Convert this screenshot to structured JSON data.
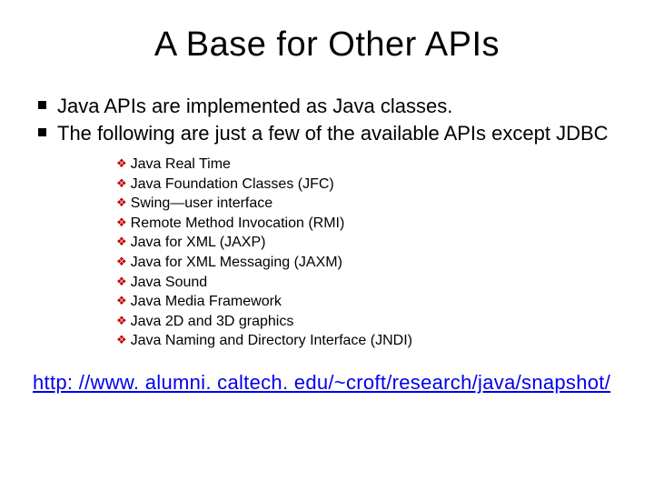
{
  "title": "A Base for Other APIs",
  "level1": [
    "Java APIs  are implemented as Java classes.",
    "The following are just a few of the available APIs except JDBC"
  ],
  "level2": [
    "Java Real Time",
    "Java Foundation Classes (JFC)",
    "Swing—user interface",
    "Remote Method Invocation (RMI)",
    "Java for XML (JAXP)",
    "Java for XML Messaging (JAXM)",
    "Java Sound",
    "Java Media Framework",
    "Java 2D and 3D graphics",
    "Java Naming and Directory Interface (JNDI)"
  ],
  "link": "http: //www. alumni. caltech. edu/~croft/research/java/snapshot/"
}
